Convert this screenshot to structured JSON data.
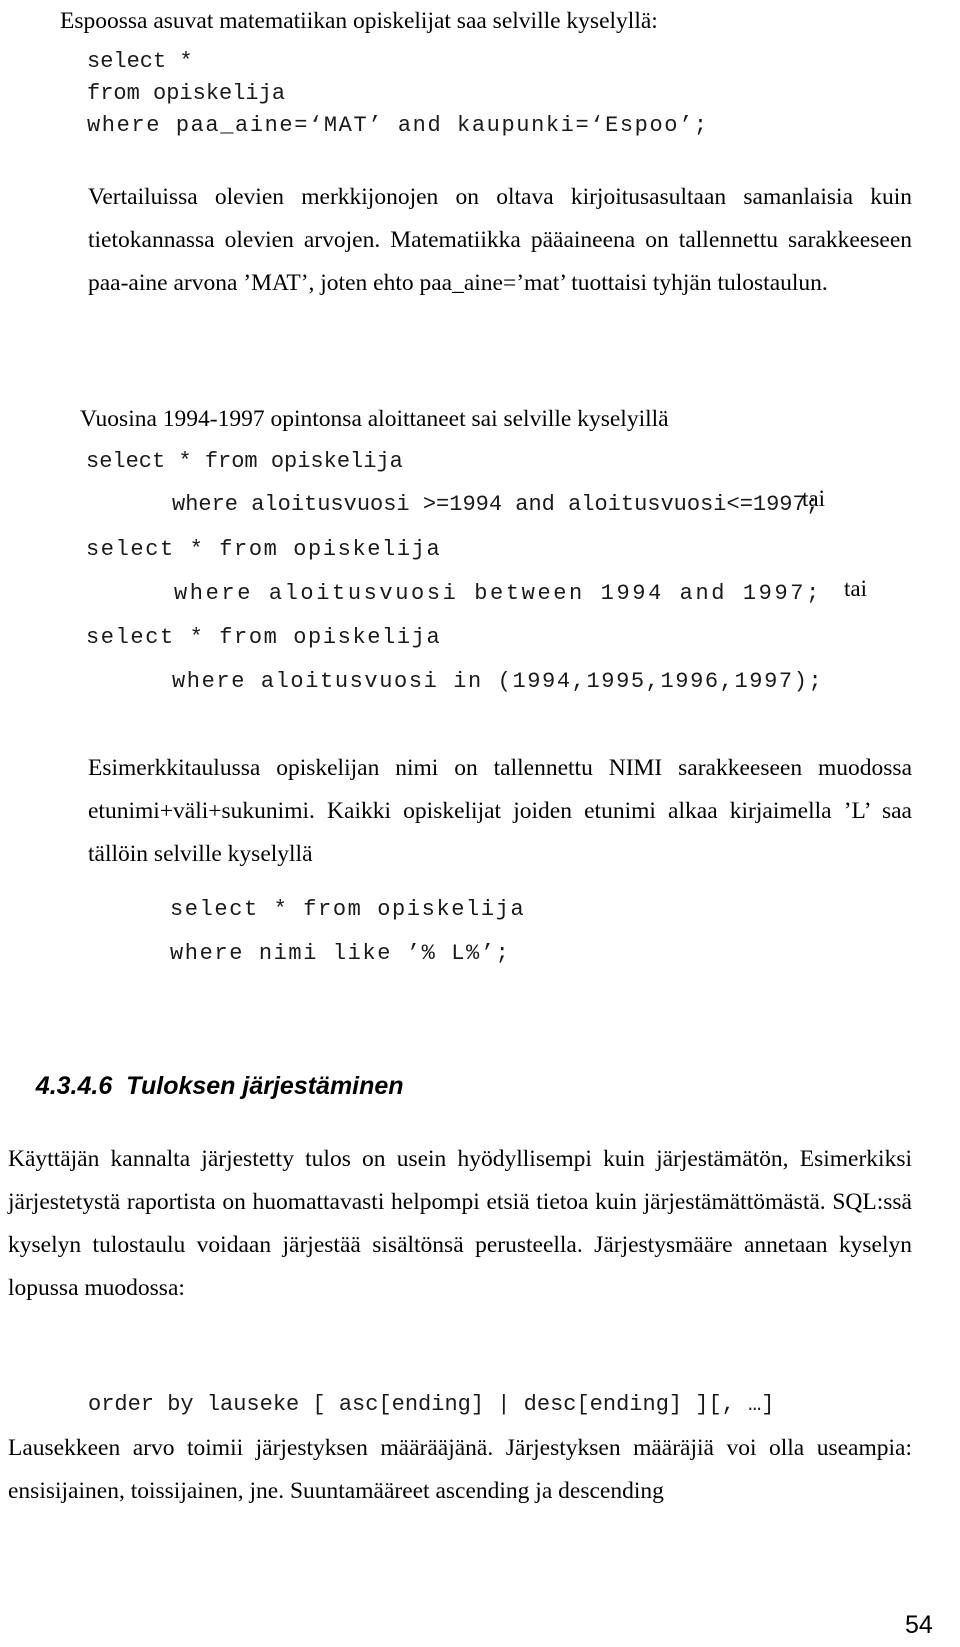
{
  "document": {
    "page_number": "54",
    "language": "fi"
  },
  "blocks": {
    "intro_line": "Espoossa asuvat matematiikan opiskelijat saa selville kyselyllä:",
    "code_block_1": {
      "line1": "select *",
      "line2": "from opiskelija",
      "line3": "where paa_aine=‘MAT’ and kaupunki=‘Espoo’;"
    },
    "paragraph_1": "Vertailuissa olevien merkkijonojen on oltava kirjoitusasultaan samanlaisia kuin tietokannassa olevien arvojen. Matematiikka pääaineena on tallennettu sarakkeeseen paa-aine arvona ’MAT’, joten ehto paa_aine=’mat’ tuottaisi tyhjän tulostaulun.",
    "years_heading": "Vuosina 1994-1997 opintonsa aloittaneet sai selville kyselyillä",
    "code_block_2": {
      "select_1": "select * from opiskelija",
      "where_1": "where aloitusvuosi >=1994 and aloitusvuosi<=1997;",
      "tai_1": "tai",
      "select_2": "select * from opiskelija",
      "where_2": "where aloitusvuosi between 1994 and 1997;",
      "tai_2": "tai",
      "select_3": "select * from opiskelija",
      "where_3": "where aloitusvuosi in (1994,1995,1996,1997);"
    },
    "paragraph_2": "Esimerkkitaulussa opiskelijan nimi on tallennettu NIMI sarakkeeseen muodossa etunimi+väli+sukunimi.  Kaikki opiskelijat joiden etunimi alkaa kirjaimella ’L’ saa tällöin selville kyselyllä",
    "code_block_3": {
      "line1": "select * from opiskelija",
      "line2": "where nimi like ’% L%’;"
    },
    "section_number": "4.3.4.6",
    "section_title": "Tuloksen järjestäminen",
    "paragraph_3": "Käyttäjän kannalta järjestetty tulos on usein hyödyllisempi kuin järjestämätön, Esimerkiksi järjestetystä raportista on huomattavasti helpompi etsiä tietoa kuin järjestämättömästä.  SQL:ssä kyselyn tulostaulu voidaan järjestää sisältönsä perusteella. Järjestysmääre annetaan kyselyn lopussa muodossa:",
    "code_block_4": {
      "line1": "order by lauseke [ asc[ending] | desc[ending] ][, …]"
    },
    "paragraph_4": "Lausekkeen arvo toimii järjestyksen määrääjänä. Järjestyksen määräjiä voi olla useampia: ensisijainen, toissijainen, jne. Suuntamääreet ascending ja descending"
  },
  "colors": {
    "page_background": "#ffffff",
    "text": "#000000",
    "code_text": "#1a1a1a"
  }
}
